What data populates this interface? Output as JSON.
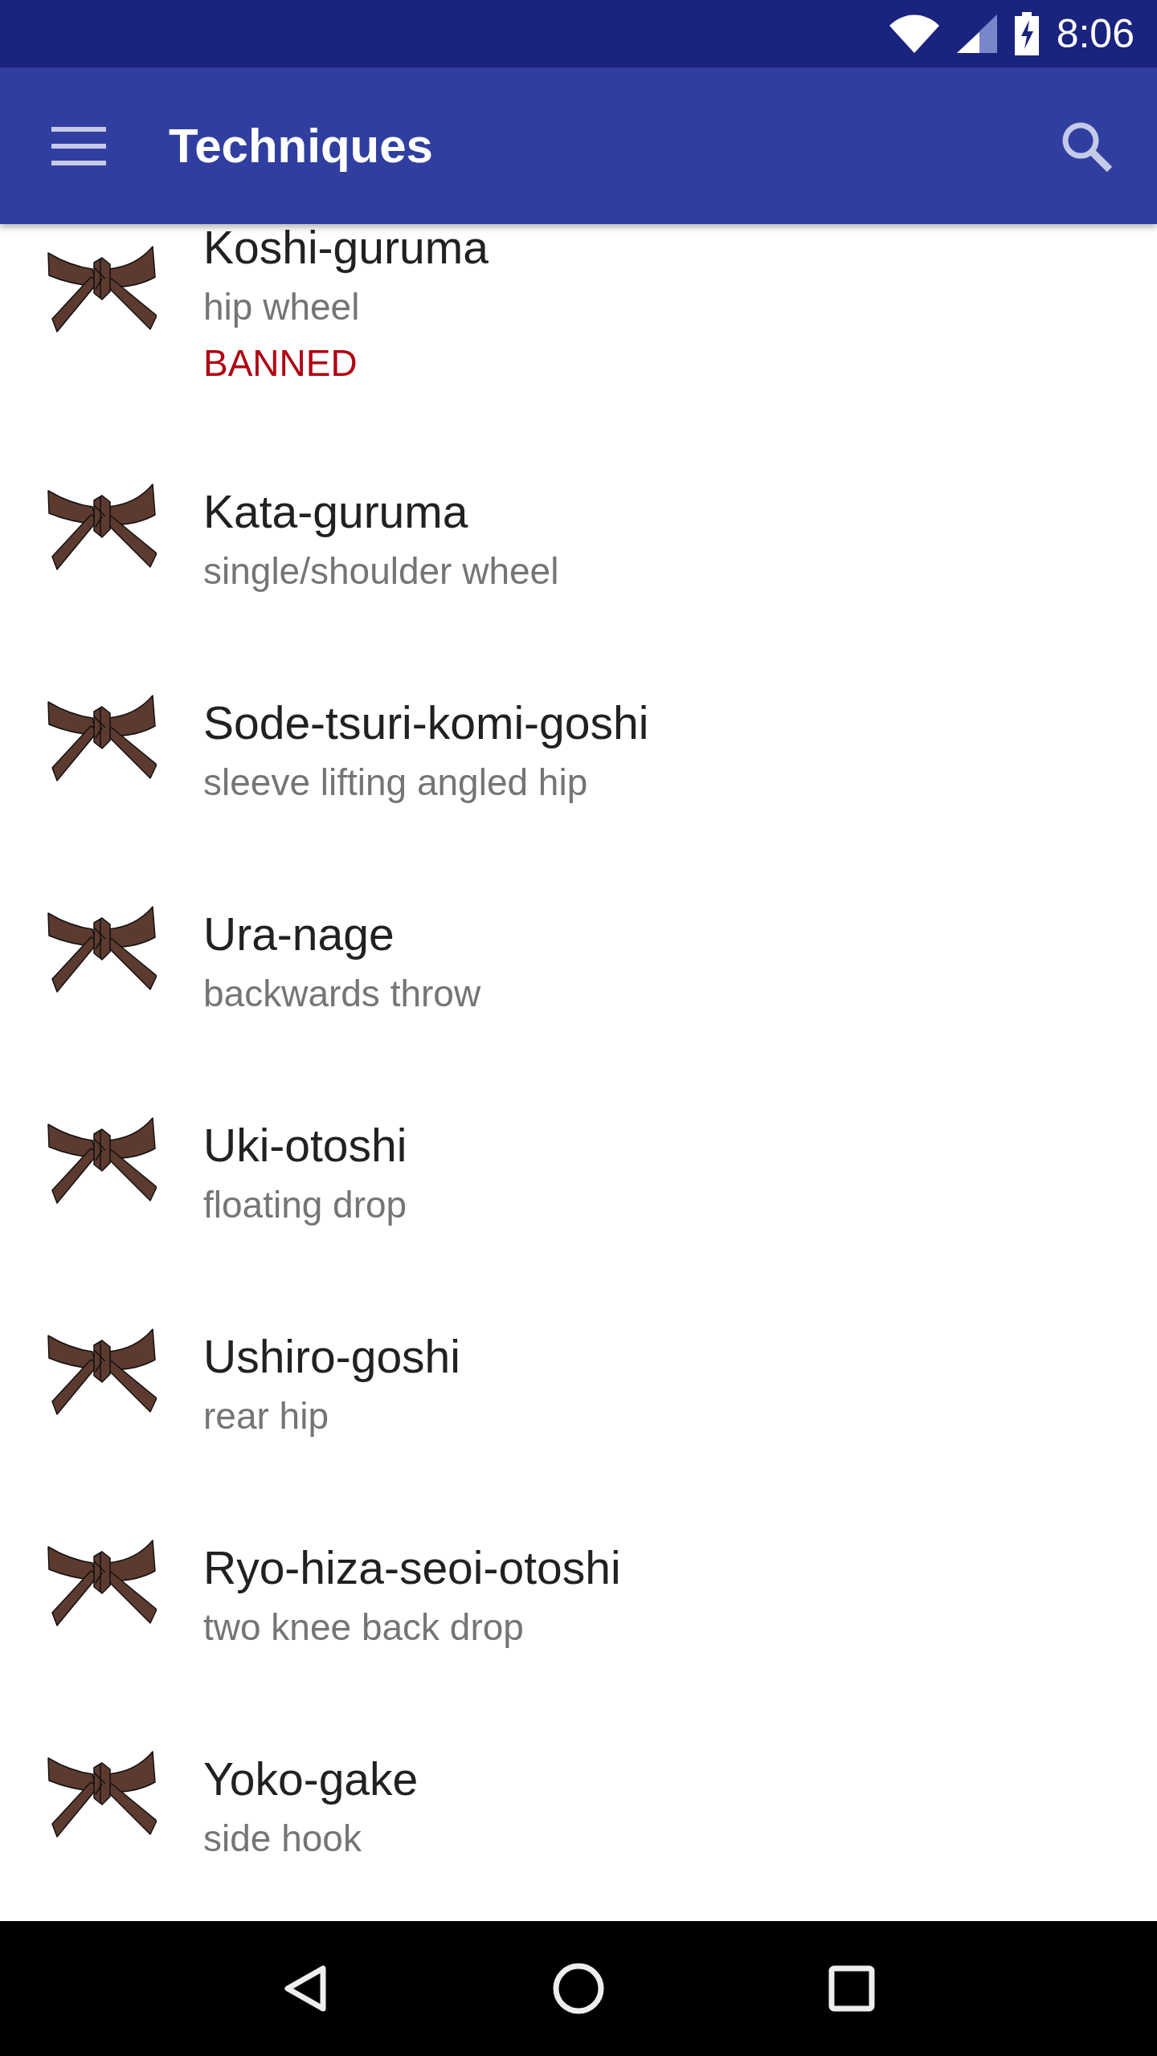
{
  "status_bar": {
    "time": "8:06"
  },
  "app_bar": {
    "title": "Techniques"
  },
  "techniques": [
    {
      "name": "Koshi-guruma",
      "translation": "hip wheel",
      "tag": "BANNED"
    },
    {
      "name": "Kata-guruma",
      "translation": "single/shoulder wheel"
    },
    {
      "name": "Sode-tsuri-komi-goshi",
      "translation": "sleeve lifting angled hip"
    },
    {
      "name": "Ura-nage",
      "translation": "backwards throw"
    },
    {
      "name": "Uki-otoshi",
      "translation": "floating drop"
    },
    {
      "name": "Ushiro-goshi",
      "translation": "rear hip"
    },
    {
      "name": "Ryo-hiza-seoi-otoshi",
      "translation": "two knee back drop"
    },
    {
      "name": "Yoko-gake",
      "translation": "side hook"
    }
  ]
}
